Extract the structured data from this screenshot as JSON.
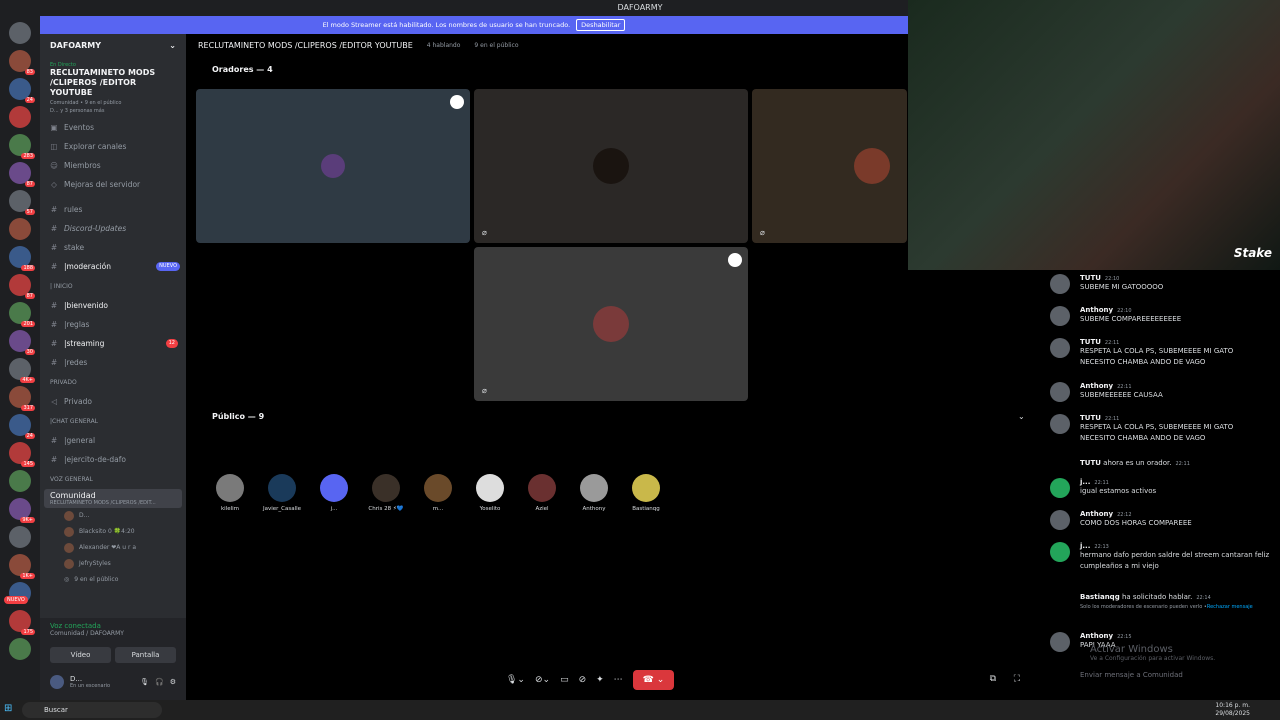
{
  "window": {
    "title": "DAFOARMY"
  },
  "banner": {
    "text": "El modo Streamer está habilitado. Los nombres de usuario se han truncado.",
    "button": "Deshabilitar"
  },
  "sidebar": {
    "new_label": "NUEVO",
    "server_badges": [
      "",
      "83",
      "24",
      "",
      "283",
      "87",
      "57",
      "",
      "188",
      "87",
      "201",
      "30",
      "4K+",
      "317",
      "24",
      "145",
      "",
      "9K+",
      "",
      "1K+",
      "",
      "175",
      ""
    ]
  },
  "server": {
    "name": "DAFOARMY",
    "live_tag": "En Directo",
    "live_title": "RECLUTAMINETO MODS /CLIPEROS /EDITOR YOUTUBE",
    "live_meta1": "Comunidad • 9 en el público",
    "live_meta2": "D... y 3 personas más",
    "links": [
      "Eventos",
      "Explorar canales",
      "Miembros",
      "Mejoras del servidor"
    ],
    "channels_top": [
      "rules",
      "Discord-Updates",
      "stake",
      "|moderación"
    ],
    "nuevo": "NUEVO",
    "cat_inicio": "| INICIO",
    "channels_inicio": [
      "|bienvenido",
      "|reglas",
      "|streaming",
      "|redes"
    ],
    "streaming_count": "12",
    "cat_privado": "PRIVADO",
    "channels_privado": [
      "Privado"
    ],
    "cat_chat": "|CHAT GENERAL",
    "channels_chat": [
      "|general",
      "|ejercito-de-dafo"
    ],
    "cat_voz": "VOZ GENERAL",
    "voice_channel": {
      "name": "Comunidad",
      "sub": "RECLUTAMINETO MODS /CLIPEROS /EDIT..."
    },
    "voice_users": [
      "D...",
      "Blacksito 0 🍀4:20",
      "Alexander ❤A u r a",
      "JefryStyles"
    ],
    "public_count": "9 en el público"
  },
  "connection": {
    "status": "Voz conectada",
    "where": "Comunidad / DAFOARMY",
    "video": "Vídeo",
    "screen": "Pantalla"
  },
  "user": {
    "name": "D...",
    "status": "En un escenario"
  },
  "stage": {
    "title": "RECLUTAMINETO MODS /CLIPEROS /EDITOR YOUTUBE",
    "talking": "4 hablando",
    "public": "9 en el público",
    "speakers_label": "Oradores — 4",
    "public_label": "Público — 9",
    "audience": [
      "kilelim",
      "Javier_Casalle",
      "j...",
      "Chris 28 ⚡💙",
      "m...",
      "Yoselito",
      "Aziel",
      "Anthony",
      "Bastianqg"
    ]
  },
  "chat": {
    "messages": [
      {
        "author": "TUTU",
        "time": "22:10",
        "text": "SUBEME MI GATOOOOO"
      },
      {
        "author": "Anthony",
        "time": "22:10",
        "text": "SUBEME COMPAREEEEEEEEE"
      },
      {
        "author": "TUTU",
        "time": "22:11",
        "text": "RESPETA LA COLA PS, SUBEMEEEE MI GATO NECESITO CHAMBA ANDO DE VAGO"
      },
      {
        "author": "Anthony",
        "time": "22:11",
        "text": "SUBEMEEEEEE CAUSAA"
      },
      {
        "author": "TUTU",
        "time": "22:11",
        "text": "RESPETA LA COLA PS, SUBEMEEEE MI GATO NECESITO CHAMBA ANDO DE VAGO"
      },
      {
        "author": "j...",
        "time": "22:11",
        "text": "igual estamos activos"
      },
      {
        "author": "Anthony",
        "time": "22:12",
        "text": "COMO DOS HORAS COMPAREEE"
      },
      {
        "author": "j...",
        "time": "22:13",
        "text": "hermano dafo perdon saldre del streem cantaran feliz cumpleaños a mi viejo"
      },
      {
        "author": "Anthony",
        "time": "22:15",
        "text": "PAPI YAAA"
      }
    ],
    "system_orator": {
      "user": "TUTU",
      "text": "ahora es un orador.",
      "time": "22:11"
    },
    "system_request": {
      "user": "Bastianqg",
      "text": "ha solicitado hablar.",
      "time": "22:14"
    },
    "request_note": "Solo los moderadores de escenario pueden verlo •",
    "request_action": "Rechazar mensaje",
    "input_placeholder": "Enviar mensaje a Comunidad"
  },
  "watermark": {
    "line1": "Activar Windows",
    "line2": "Ve a Configuración para activar Windows."
  },
  "stream_overlay": {
    "sponsor": "Stake"
  },
  "taskbar": {
    "search": "Buscar",
    "time": "10:16 p. m.",
    "date": "29/08/2025"
  },
  "colors": {
    "accent": "#5865f2",
    "green": "#23a55a",
    "red": "#da373c",
    "bg": "#000000",
    "sidebar": "#2b2d31"
  }
}
